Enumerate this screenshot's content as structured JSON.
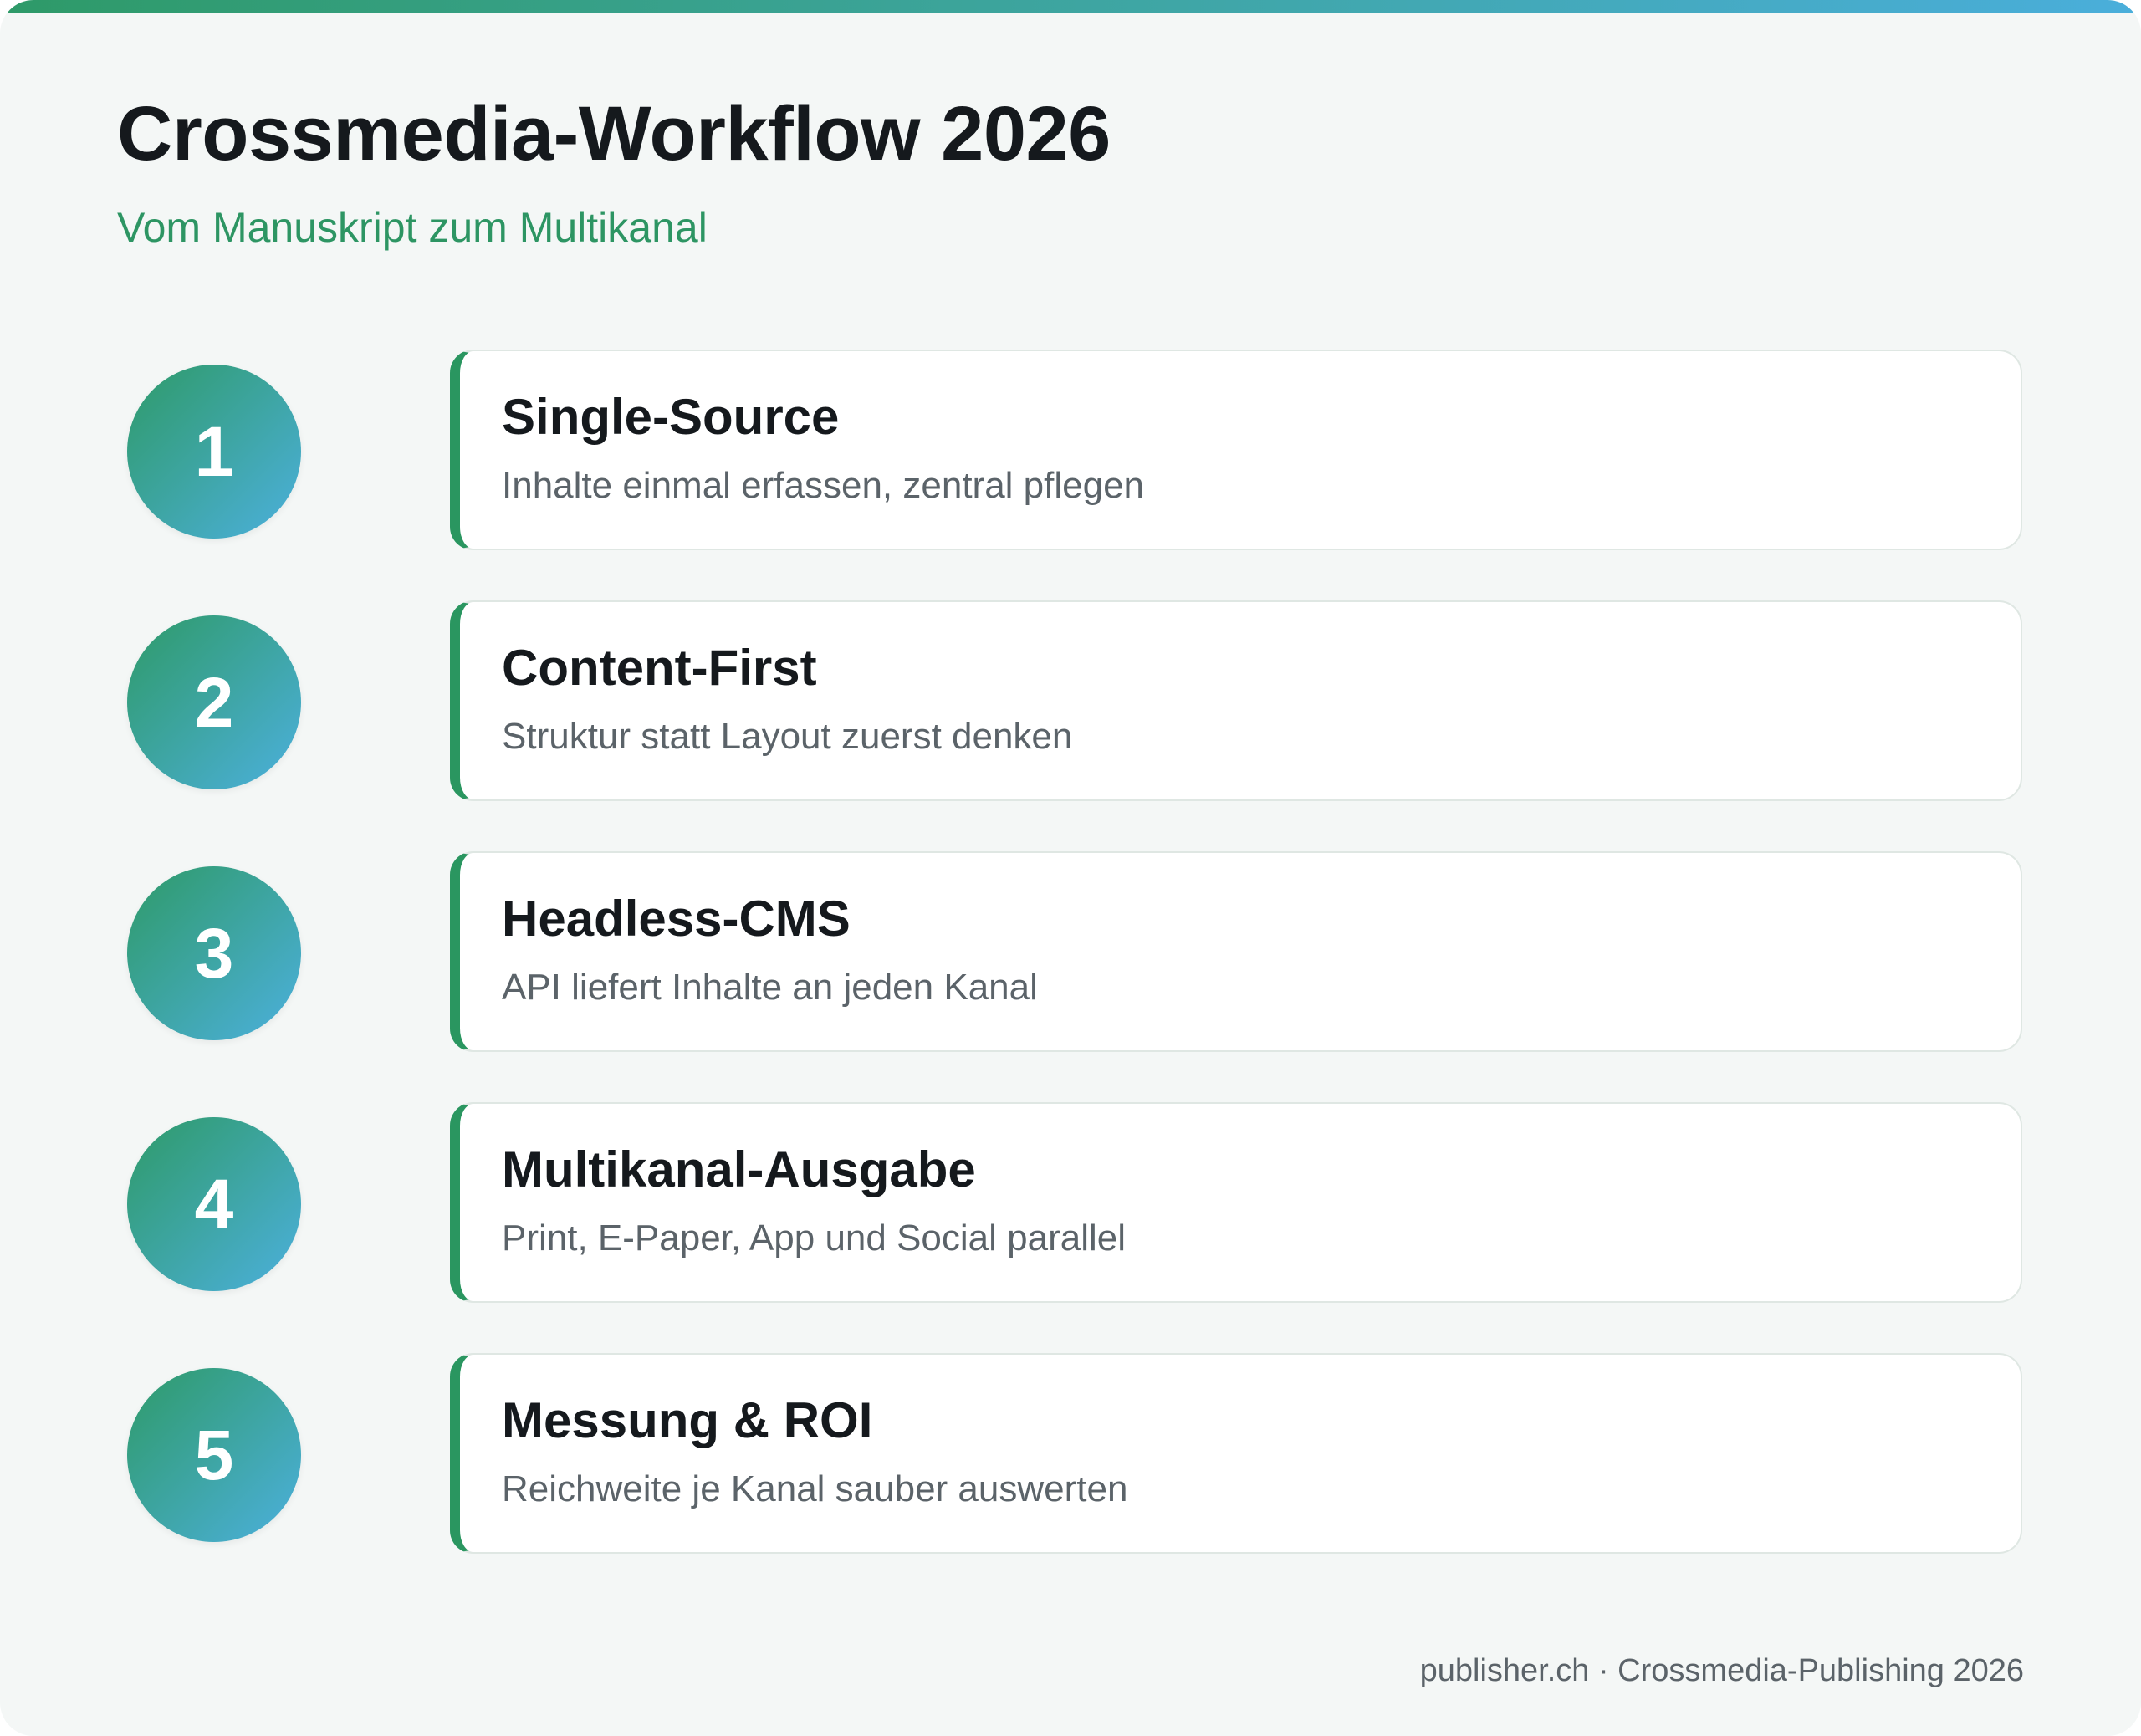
{
  "header": {
    "title": "Crossmedia-Workflow 2026",
    "subtitle": "Vom Manuskript zum Multikanal"
  },
  "steps": [
    {
      "number": "1",
      "title": "Single-Source",
      "description": "Inhalte einmal erfassen, zentral pflegen"
    },
    {
      "number": "2",
      "title": "Content-First",
      "description": "Struktur statt Layout zuerst denken"
    },
    {
      "number": "3",
      "title": "Headless-CMS",
      "description": "API liefert Inhalte an jeden Kanal"
    },
    {
      "number": "4",
      "title": "Multikanal-Ausgabe",
      "description": "Print, E-Paper, App und Social parallel"
    },
    {
      "number": "5",
      "title": "Messung & ROI",
      "description": "Reichweite je Kanal sauber auswerten"
    }
  ],
  "footer": {
    "text": "publisher.ch · Crossmedia-Publishing 2026"
  },
  "colors": {
    "accent_green": "#2a9660",
    "accent_blue": "#4aaedb",
    "title_text": "#15191d",
    "muted_text": "#5b6369",
    "background": "#f4f7f6"
  }
}
